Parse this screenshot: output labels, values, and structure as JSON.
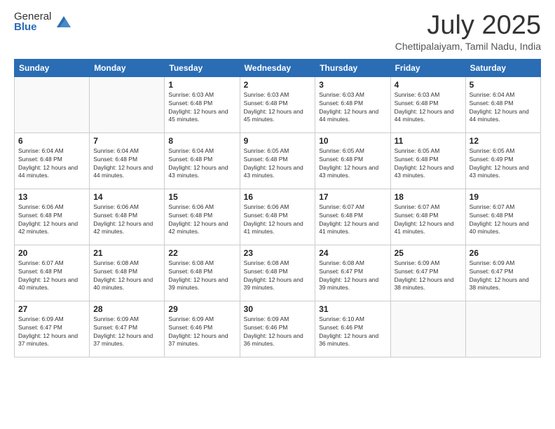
{
  "logo": {
    "general": "General",
    "blue": "Blue"
  },
  "header": {
    "month": "July 2025",
    "location": "Chettipalaiyam, Tamil Nadu, India"
  },
  "days_of_week": [
    "Sunday",
    "Monday",
    "Tuesday",
    "Wednesday",
    "Thursday",
    "Friday",
    "Saturday"
  ],
  "weeks": [
    [
      {
        "day": "",
        "info": ""
      },
      {
        "day": "",
        "info": ""
      },
      {
        "day": "1",
        "info": "Sunrise: 6:03 AM\nSunset: 6:48 PM\nDaylight: 12 hours and 45 minutes."
      },
      {
        "day": "2",
        "info": "Sunrise: 6:03 AM\nSunset: 6:48 PM\nDaylight: 12 hours and 45 minutes."
      },
      {
        "day": "3",
        "info": "Sunrise: 6:03 AM\nSunset: 6:48 PM\nDaylight: 12 hours and 44 minutes."
      },
      {
        "day": "4",
        "info": "Sunrise: 6:03 AM\nSunset: 6:48 PM\nDaylight: 12 hours and 44 minutes."
      },
      {
        "day": "5",
        "info": "Sunrise: 6:04 AM\nSunset: 6:48 PM\nDaylight: 12 hours and 44 minutes."
      }
    ],
    [
      {
        "day": "6",
        "info": "Sunrise: 6:04 AM\nSunset: 6:48 PM\nDaylight: 12 hours and 44 minutes."
      },
      {
        "day": "7",
        "info": "Sunrise: 6:04 AM\nSunset: 6:48 PM\nDaylight: 12 hours and 44 minutes."
      },
      {
        "day": "8",
        "info": "Sunrise: 6:04 AM\nSunset: 6:48 PM\nDaylight: 12 hours and 43 minutes."
      },
      {
        "day": "9",
        "info": "Sunrise: 6:05 AM\nSunset: 6:48 PM\nDaylight: 12 hours and 43 minutes."
      },
      {
        "day": "10",
        "info": "Sunrise: 6:05 AM\nSunset: 6:48 PM\nDaylight: 12 hours and 43 minutes."
      },
      {
        "day": "11",
        "info": "Sunrise: 6:05 AM\nSunset: 6:48 PM\nDaylight: 12 hours and 43 minutes."
      },
      {
        "day": "12",
        "info": "Sunrise: 6:05 AM\nSunset: 6:49 PM\nDaylight: 12 hours and 43 minutes."
      }
    ],
    [
      {
        "day": "13",
        "info": "Sunrise: 6:06 AM\nSunset: 6:48 PM\nDaylight: 12 hours and 42 minutes."
      },
      {
        "day": "14",
        "info": "Sunrise: 6:06 AM\nSunset: 6:48 PM\nDaylight: 12 hours and 42 minutes."
      },
      {
        "day": "15",
        "info": "Sunrise: 6:06 AM\nSunset: 6:48 PM\nDaylight: 12 hours and 42 minutes."
      },
      {
        "day": "16",
        "info": "Sunrise: 6:06 AM\nSunset: 6:48 PM\nDaylight: 12 hours and 41 minutes."
      },
      {
        "day": "17",
        "info": "Sunrise: 6:07 AM\nSunset: 6:48 PM\nDaylight: 12 hours and 41 minutes."
      },
      {
        "day": "18",
        "info": "Sunrise: 6:07 AM\nSunset: 6:48 PM\nDaylight: 12 hours and 41 minutes."
      },
      {
        "day": "19",
        "info": "Sunrise: 6:07 AM\nSunset: 6:48 PM\nDaylight: 12 hours and 40 minutes."
      }
    ],
    [
      {
        "day": "20",
        "info": "Sunrise: 6:07 AM\nSunset: 6:48 PM\nDaylight: 12 hours and 40 minutes."
      },
      {
        "day": "21",
        "info": "Sunrise: 6:08 AM\nSunset: 6:48 PM\nDaylight: 12 hours and 40 minutes."
      },
      {
        "day": "22",
        "info": "Sunrise: 6:08 AM\nSunset: 6:48 PM\nDaylight: 12 hours and 39 minutes."
      },
      {
        "day": "23",
        "info": "Sunrise: 6:08 AM\nSunset: 6:48 PM\nDaylight: 12 hours and 39 minutes."
      },
      {
        "day": "24",
        "info": "Sunrise: 6:08 AM\nSunset: 6:47 PM\nDaylight: 12 hours and 39 minutes."
      },
      {
        "day": "25",
        "info": "Sunrise: 6:09 AM\nSunset: 6:47 PM\nDaylight: 12 hours and 38 minutes."
      },
      {
        "day": "26",
        "info": "Sunrise: 6:09 AM\nSunset: 6:47 PM\nDaylight: 12 hours and 38 minutes."
      }
    ],
    [
      {
        "day": "27",
        "info": "Sunrise: 6:09 AM\nSunset: 6:47 PM\nDaylight: 12 hours and 37 minutes."
      },
      {
        "day": "28",
        "info": "Sunrise: 6:09 AM\nSunset: 6:47 PM\nDaylight: 12 hours and 37 minutes."
      },
      {
        "day": "29",
        "info": "Sunrise: 6:09 AM\nSunset: 6:46 PM\nDaylight: 12 hours and 37 minutes."
      },
      {
        "day": "30",
        "info": "Sunrise: 6:09 AM\nSunset: 6:46 PM\nDaylight: 12 hours and 36 minutes."
      },
      {
        "day": "31",
        "info": "Sunrise: 6:10 AM\nSunset: 6:46 PM\nDaylight: 12 hours and 36 minutes."
      },
      {
        "day": "",
        "info": ""
      },
      {
        "day": "",
        "info": ""
      }
    ]
  ]
}
